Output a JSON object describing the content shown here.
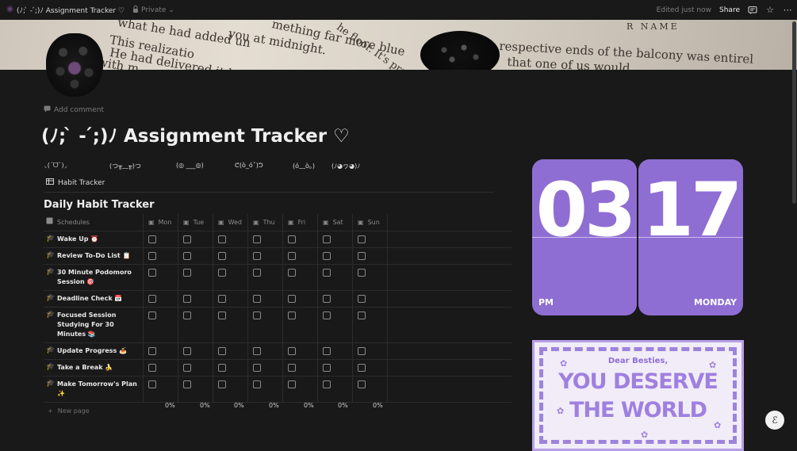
{
  "topbar": {
    "page_title": "(ﾉ; ̀ - ́;)ﾉ Assignment Tracker ♡",
    "privacy": "Private",
    "edited": "Edited just now",
    "share": "Share"
  },
  "cover": {
    "lines": [
      "what he had added un",
      "This realizatio",
      "He had delivered it h",
      "with m",
      "you at midnight.",
      "mething far more blue",
      "he floor. It's probab",
      "respective ends of the balcony was entirel",
      "that one of us would"
    ],
    "name_label": "R NAME"
  },
  "add_comment": "Add comment",
  "title": "(ﾉ; ̀ - ́;)ﾉ  Assignment  Tracker ♡",
  "kaomoji": [
    "⸜(ˊᗜˋ)⸝",
    "(つ╥﹏╥)つ",
    "(◎ ___◎)",
    "ᕦ(ò_óˇ)ᕤ",
    "(ó﹏ò｡)",
    "(ﾉ◕ヮ◕)ﾉ"
  ],
  "view_tab": "Habit Tracker",
  "database": {
    "title": "Daily Habit Tracker",
    "columns": [
      "Schedules",
      "Mon",
      "Tue",
      "Wed",
      "Thu",
      "Fri",
      "Sat",
      "Sun"
    ],
    "rows": [
      {
        "name": "Wake Up ⏰"
      },
      {
        "name": "Review To-Do List 📋"
      },
      {
        "name": "30 Minute Podomoro Session 🎯"
      },
      {
        "name": "Deadline Check 📅"
      },
      {
        "name": "Focused Session Studying For 30 Minutes 📚"
      },
      {
        "name": "Update Progress 🍝"
      },
      {
        "name": "Take a Break 🍌"
      },
      {
        "name": "Make Tomorrow's Plan ✨"
      }
    ],
    "new_page": "New page",
    "percentages": [
      "0%",
      "0%",
      "0%",
      "0%",
      "0%",
      "0%",
      "0%"
    ]
  },
  "clock": {
    "hours": "03",
    "minutes": "17",
    "ampm": "PM",
    "day": "MONDAY"
  },
  "poster": {
    "greeting": "Dear Besties,",
    "line1": "YOU DESERVE",
    "line2": "THE WORLD"
  },
  "colors": {
    "accent_purple": "#8f6ed3",
    "background": "#191919"
  },
  "icons": {
    "page_icon": "blackberry-image",
    "comment": "comment-icon",
    "table": "table-icon",
    "row": "graduation-cap-icon",
    "column": "calendar-icon",
    "fab": "help-icon"
  }
}
